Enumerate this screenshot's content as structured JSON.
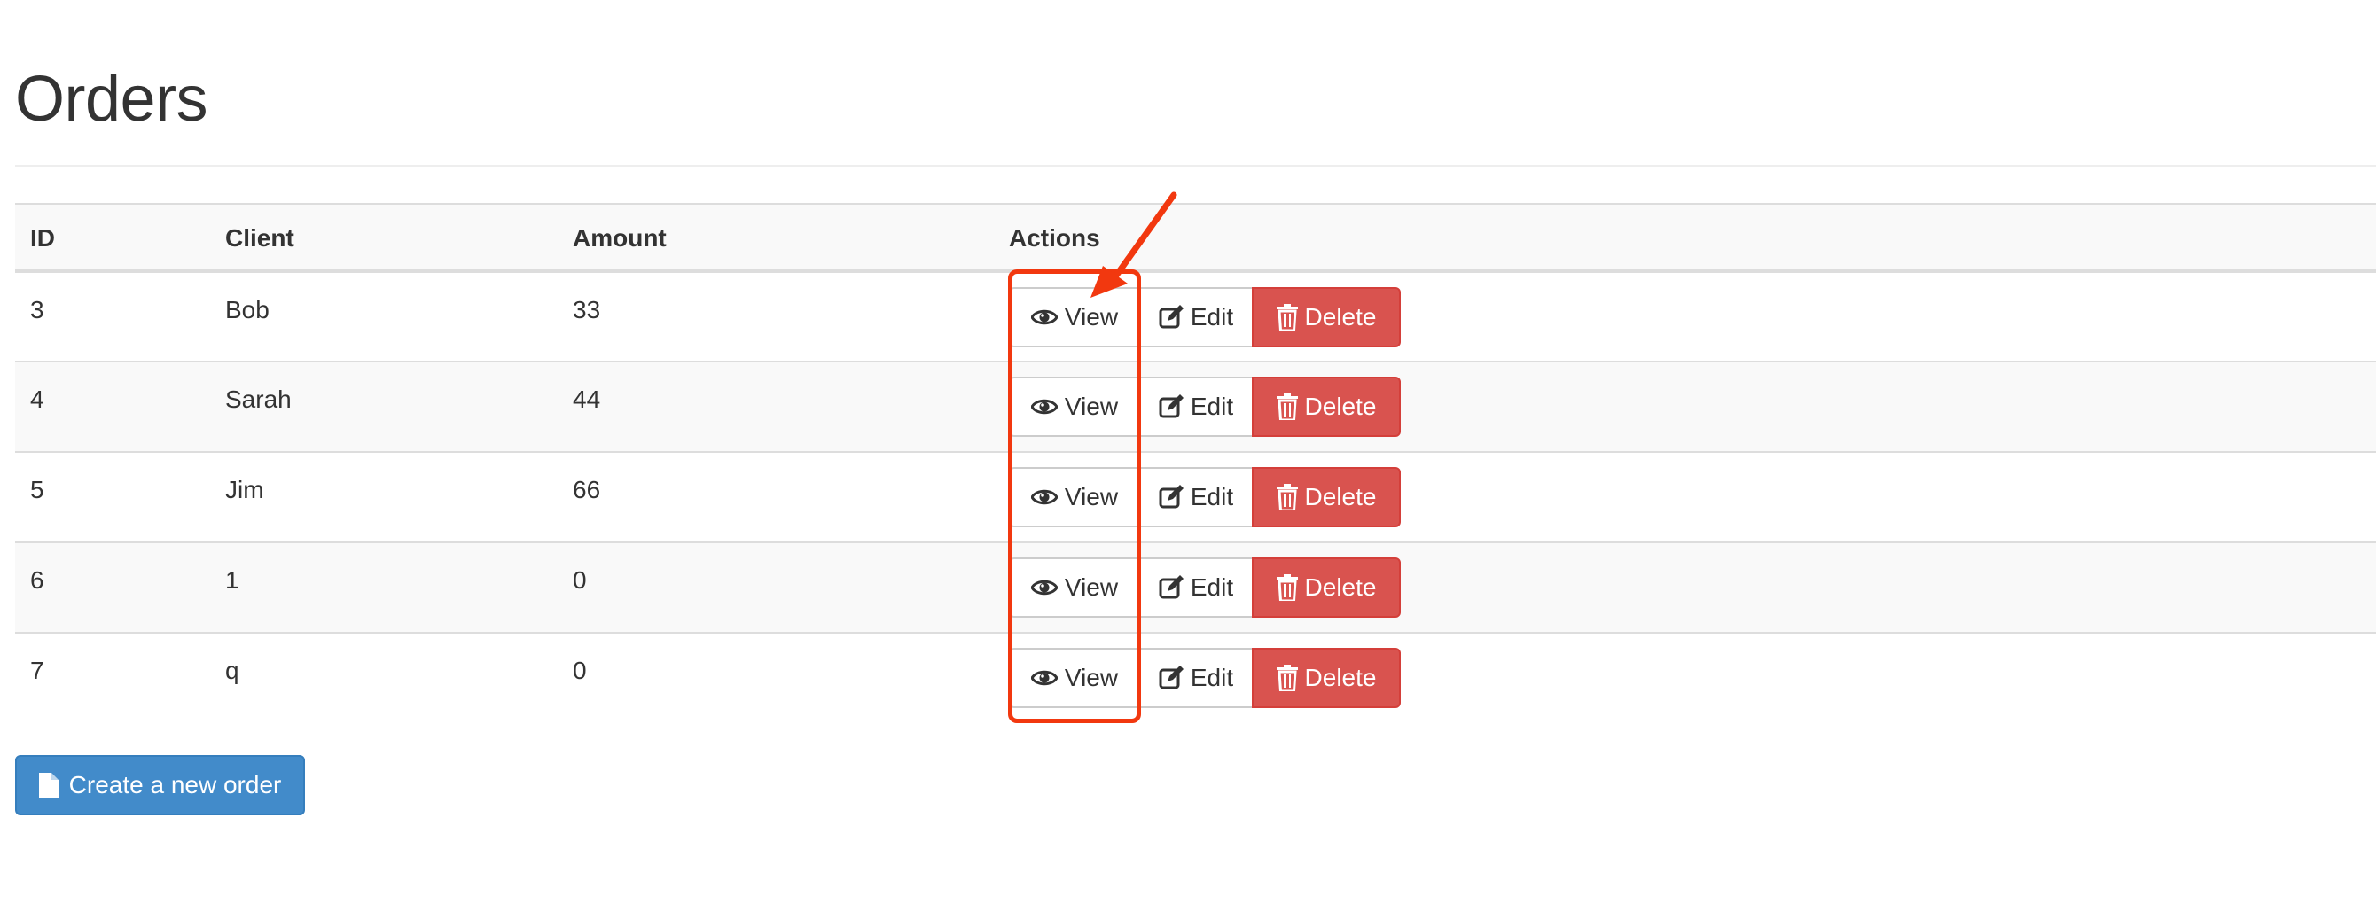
{
  "page": {
    "title": "Orders"
  },
  "table": {
    "headers": {
      "id": "ID",
      "client": "Client",
      "amount": "Amount",
      "actions": "Actions"
    },
    "rows": [
      {
        "id": "3",
        "client": "Bob",
        "amount": "33"
      },
      {
        "id": "4",
        "client": "Sarah",
        "amount": "44"
      },
      {
        "id": "5",
        "client": "Jim",
        "amount": "66"
      },
      {
        "id": "6",
        "client": "1",
        "amount": "0"
      },
      {
        "id": "7",
        "client": "q",
        "amount": "0"
      }
    ],
    "actions": {
      "view_label": "View",
      "edit_label": "Edit",
      "delete_label": "Delete"
    }
  },
  "create_button": {
    "label": "Create a new order"
  },
  "icons": {
    "view": "eye-icon",
    "edit": "edit-icon",
    "delete": "trash-icon",
    "create": "file-icon"
  },
  "colors": {
    "delete": "#d9534f",
    "primary": "#428bca",
    "annotation": "#f2380f"
  }
}
